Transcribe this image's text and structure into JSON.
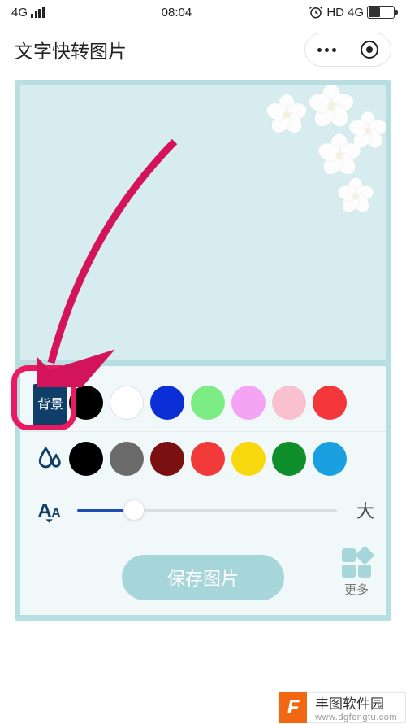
{
  "status": {
    "network_left": "4G",
    "time": "08:04",
    "hd": "HD",
    "network_right": "4G"
  },
  "header": {
    "title": "文字快转图片"
  },
  "controls": {
    "bg_chip_label": "背景",
    "bg_swatches": [
      {
        "color": "#000000"
      },
      {
        "color": "#ffffff",
        "white": true
      },
      {
        "color": "#0b2fd6"
      },
      {
        "color": "#7ced85"
      },
      {
        "color": "#f5a4f5"
      },
      {
        "color": "#f9c1d0"
      },
      {
        "color": "#f2363a"
      }
    ],
    "text_swatches": [
      {
        "color": "#000000"
      },
      {
        "color": "#6b6b6b"
      },
      {
        "color": "#7a1010"
      },
      {
        "color": "#f23a3a"
      },
      {
        "color": "#f7d80e"
      },
      {
        "color": "#0f8f2b"
      },
      {
        "color": "#1aa0e0"
      }
    ],
    "size_label": "大",
    "slider_pct": 22
  },
  "footer": {
    "save_label": "保存图片",
    "more_label": "更多"
  },
  "watermark": {
    "logo": "F",
    "name": "丰图软件园",
    "url": "www.dgfengtu.com"
  }
}
